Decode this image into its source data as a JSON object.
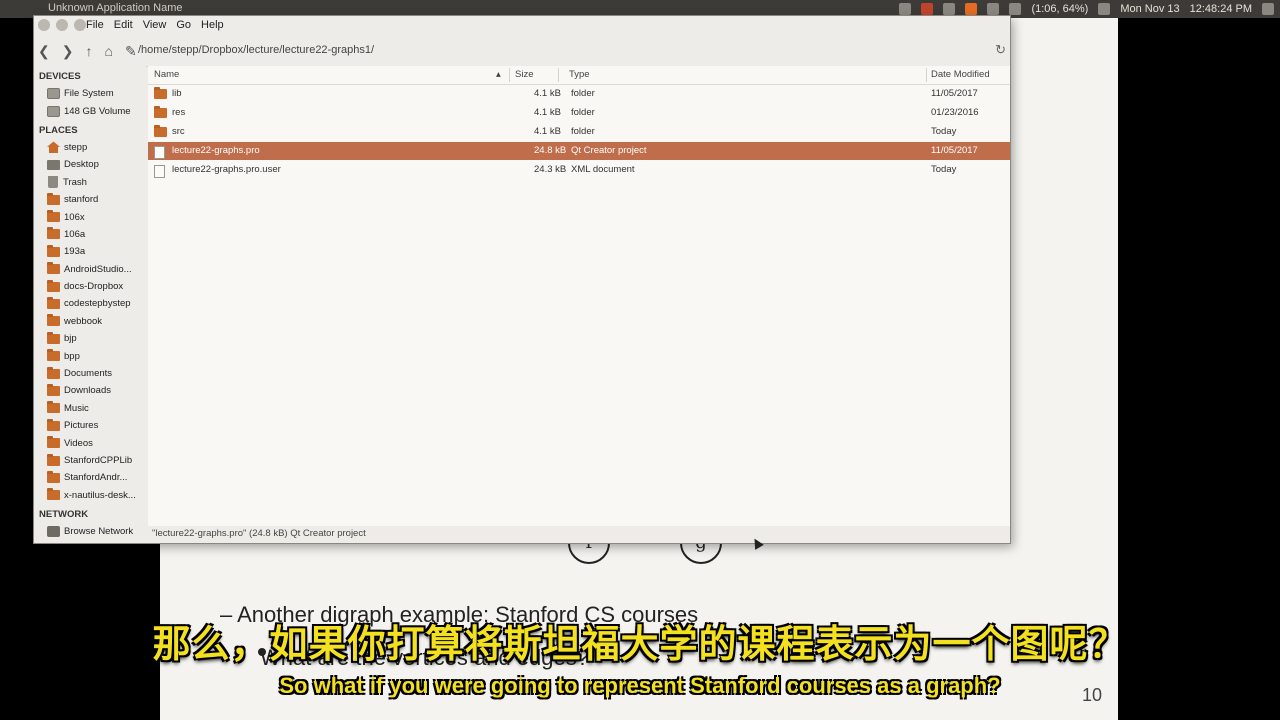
{
  "top_panel": {
    "app_name": "Unknown Application Name",
    "battery": "(1:06, 64%)",
    "date": "Mon Nov 13",
    "time": "12:48:24 PM"
  },
  "window": {
    "menu": [
      "File",
      "Edit",
      "View",
      "Go",
      "Help"
    ],
    "path": "/home/stepp/Dropbox/lecture/lecture22-graphs1/",
    "sidebar": {
      "devices_label": "DEVICES",
      "devices": [
        {
          "label": "File System",
          "icon": "drive-icon"
        },
        {
          "label": "148 GB Volume",
          "icon": "drive-icon"
        }
      ],
      "places_label": "PLACES",
      "places": [
        {
          "label": "stepp",
          "icon": "home-icon"
        },
        {
          "label": "Desktop",
          "icon": "desktop-icon"
        },
        {
          "label": "Trash",
          "icon": "trash-icon"
        },
        {
          "label": "stanford",
          "icon": "folder-icon"
        },
        {
          "label": "106x",
          "icon": "folder-icon"
        },
        {
          "label": "106a",
          "icon": "folder-icon"
        },
        {
          "label": "193a",
          "icon": "folder-icon"
        },
        {
          "label": "AndroidStudio...",
          "icon": "folder-icon"
        },
        {
          "label": "docs-Dropbox",
          "icon": "folder-icon"
        },
        {
          "label": "codestepbystep",
          "icon": "folder-icon"
        },
        {
          "label": "webbook",
          "icon": "folder-icon"
        },
        {
          "label": "bjp",
          "icon": "folder-icon"
        },
        {
          "label": "bpp",
          "icon": "folder-icon"
        },
        {
          "label": "Documents",
          "icon": "folder-icon"
        },
        {
          "label": "Downloads",
          "icon": "folder-icon"
        },
        {
          "label": "Music",
          "icon": "folder-icon"
        },
        {
          "label": "Pictures",
          "icon": "folder-icon"
        },
        {
          "label": "Videos",
          "icon": "folder-icon"
        },
        {
          "label": "StanfordCPPLib",
          "icon": "folder-icon"
        },
        {
          "label": "StanfordAndr...",
          "icon": "folder-icon"
        },
        {
          "label": "x-nautilus-desk...",
          "icon": "folder-icon"
        }
      ],
      "network_label": "NETWORK",
      "network": [
        {
          "label": "Browse Network",
          "icon": "network-icon"
        }
      ]
    },
    "columns": {
      "name": "Name",
      "size": "Size",
      "type": "Type",
      "date": "Date Modified"
    },
    "files": [
      {
        "name": "lib",
        "size": "4.1 kB",
        "type": "folder",
        "date": "11/05/2017",
        "icon": "folder-icon",
        "selected": false
      },
      {
        "name": "res",
        "size": "4.1 kB",
        "type": "folder",
        "date": "01/23/2016",
        "icon": "folder-icon",
        "selected": false
      },
      {
        "name": "src",
        "size": "4.1 kB",
        "type": "folder",
        "date": "Today",
        "icon": "folder-icon",
        "selected": false
      },
      {
        "name": "lecture22-graphs.pro",
        "size": "24.8 kB",
        "type": "Qt Creator project",
        "date": "11/05/2017",
        "icon": "document-icon",
        "selected": true
      },
      {
        "name": "lecture22-graphs.pro.user",
        "size": "24.3 kB",
        "type": "XML document",
        "date": "Today",
        "icon": "document-icon",
        "selected": false
      }
    ],
    "status": "\"lecture22-graphs.pro\" (24.8 kB) Qt Creator project"
  },
  "slide": {
    "node_f": "f",
    "node_g": "g",
    "bullet1": "– Another digraph example: Stanford CS courses",
    "bullet2": "What are the vertices and edges?",
    "page_number": "10"
  },
  "subtitles": {
    "chinese": "那么，如果你打算将斯坦福大学的课程表示为一个图呢？",
    "english": "So what if you were going to represent Stanford courses as a graph?"
  }
}
